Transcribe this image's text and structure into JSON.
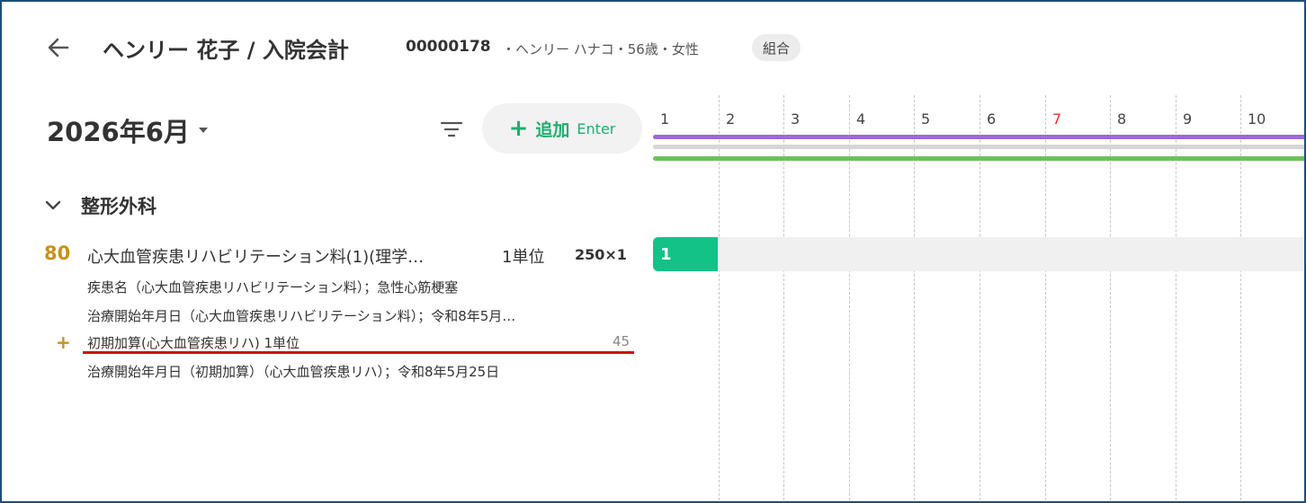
{
  "header": {
    "title": "ヘンリー 花子 / 入院会計",
    "patient_id": "00000178",
    "patient_info": "・ヘンリー ハナコ・56歳・女性",
    "insurance_badge": "組合"
  },
  "toolbar": {
    "month": "2026年6月",
    "add_label": "追加",
    "add_shortcut": "Enter"
  },
  "section": {
    "label": "整形外科"
  },
  "item": {
    "points": "80",
    "name": "心大血管疾患リハビリテーション料(1)(理学…",
    "unit": "1単位",
    "quantity": "250×1",
    "disease_line": "疾患名（心大血管疾患リハビリテーション料）；急性心筋梗塞",
    "start_date_line": "治療開始年月日（心大血管疾患リハビリテーション料）；令和8年5月…",
    "addon": {
      "name": "初期加算(心大血管疾患リハ) 1単位",
      "points": "45",
      "start_date_line": "治療開始年月日（初期加算）（心大血管疾患リハ）；令和8年5月25日"
    }
  },
  "calendar": {
    "days": [
      "1",
      "2",
      "3",
      "4",
      "5",
      "6",
      "7",
      "8",
      "9",
      "10"
    ],
    "highlight_day_color": "#e03030",
    "chip_label": "1",
    "colors": {
      "purple_bar": "#9b6bd8",
      "gray_bar": "#d6d6d6",
      "green_bar": "#6cc15a",
      "chip": "#12c286"
    }
  }
}
